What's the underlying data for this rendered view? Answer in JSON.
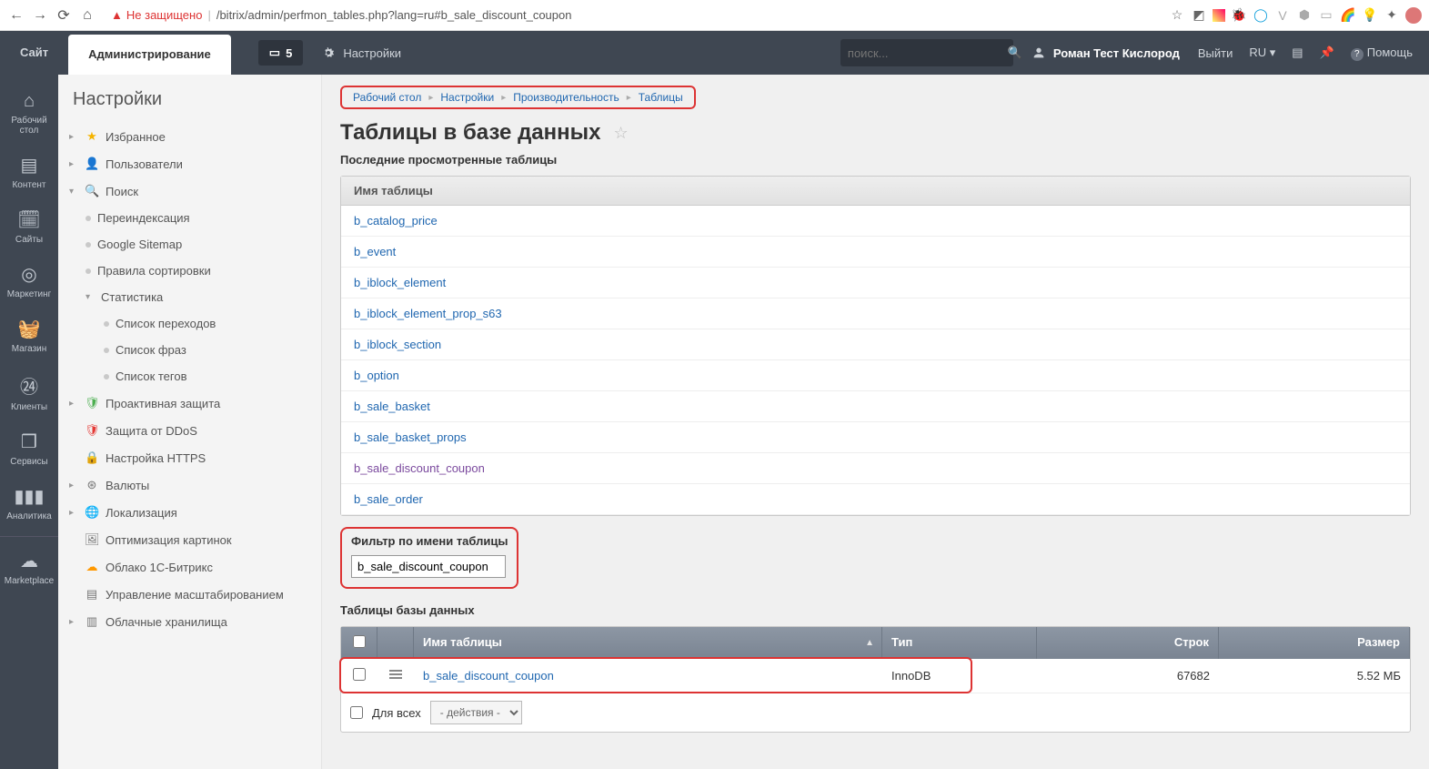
{
  "browser": {
    "insecure_label": "Не защищено",
    "url_path": "/bitrix/admin/perfmon_tables.php?lang=ru#b_sale_discount_coupon"
  },
  "topbar": {
    "tab_site": "Сайт",
    "tab_admin": "Администрирование",
    "notif_count": "5",
    "settings_label": "Настройки",
    "search_placeholder": "поиск...",
    "user_name": "Роман Тест Кислород",
    "logout": "Выйти",
    "lang": "RU",
    "help": "Помощь"
  },
  "rail": {
    "desktop": "Рабочий стол",
    "content": "Контент",
    "sites": "Сайты",
    "marketing": "Маркетинг",
    "shop": "Магазин",
    "clients": "Клиенты",
    "services": "Сервисы",
    "analytics": "Аналитика",
    "marketplace": "Marketplace"
  },
  "tree": {
    "title": "Настройки",
    "favorites": "Избранное",
    "users": "Пользователи",
    "search": "Поиск",
    "reindex": "Переиндексация",
    "sitemap": "Google Sitemap",
    "sortrules": "Правила сортировки",
    "stats": "Статистика",
    "hitlist": "Список переходов",
    "phraselist": "Список фраз",
    "taglist": "Список тегов",
    "proactive": "Проактивная защита",
    "ddos": "Защита от DDoS",
    "https": "Настройка HTTPS",
    "currency": "Валюты",
    "localization": "Локализация",
    "imgopt": "Оптимизация картинок",
    "cloud1c": "Облако 1С-Битрикс",
    "scaling": "Управление масштабированием",
    "cloudstore": "Облачные хранилища"
  },
  "breadcrumb": {
    "desktop": "Рабочий стол",
    "settings": "Настройки",
    "perf": "Производительность",
    "tables": "Таблицы"
  },
  "page": {
    "title": "Таблицы в базе данных",
    "recent_title": "Последние просмотренные таблицы",
    "recent_header": "Имя таблицы",
    "recent": [
      "b_catalog_price",
      "b_event",
      "b_iblock_element",
      "b_iblock_element_prop_s63",
      "b_iblock_section",
      "b_option",
      "b_sale_basket",
      "b_sale_basket_props",
      "b_sale_discount_coupon",
      "b_sale_order"
    ],
    "filter_title": "Фильтр по имени таблицы",
    "filter_value": "b_sale_discount_coupon",
    "grid_title": "Таблицы базы данных",
    "grid_headers": {
      "name": "Имя таблицы",
      "type": "Тип",
      "rows": "Строк",
      "size": "Размер"
    },
    "grid_row": {
      "name": "b_sale_discount_coupon",
      "type": "InnoDB",
      "rows": "67682",
      "size": "5.52 МБ"
    },
    "for_all": "Для всех",
    "actions_placeholder": "- действия -"
  }
}
